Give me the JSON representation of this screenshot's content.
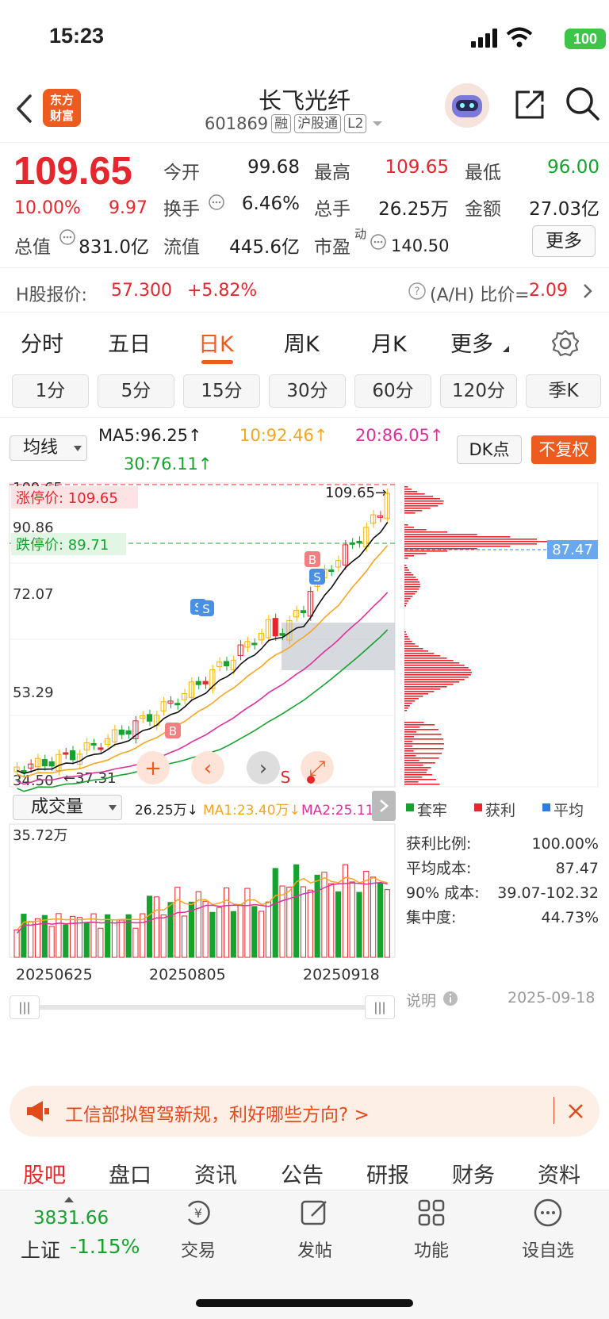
{
  "status_bar": {
    "time": "15:23",
    "battery": "100"
  },
  "header": {
    "logo_line1": "东方",
    "logo_line2": "财富",
    "stock_name": "长飞光纤",
    "stock_code": "601869",
    "tags": [
      "融",
      "沪股通",
      "L2"
    ]
  },
  "quote": {
    "price": "109.65",
    "change_pct": "10.00%",
    "change_amt": "9.97",
    "open_label": "今开",
    "open": "99.68",
    "high_label": "最高",
    "high": "109.65",
    "low_label": "最低",
    "low": "96.00",
    "turnover_rate_label": "换手",
    "turnover_rate": "6.46%",
    "volume_label": "总手",
    "volume": "26.25万",
    "amount_label": "金额",
    "amount": "27.03亿",
    "total_cap_label": "总值",
    "total_cap": "831.0亿",
    "float_cap_label": "流值",
    "float_cap": "445.6亿",
    "pe_label": "市盈",
    "pe_sup": "动",
    "pe": "140.50",
    "more_button": "更多"
  },
  "h_share": {
    "label": "H股报价:",
    "price": "57.300",
    "change": "+5.82%",
    "ratio_label": "(A/H) 比价=",
    "ratio": "2.09"
  },
  "kline_tabs": {
    "items": [
      "分时",
      "五日",
      "日K",
      "周K",
      "月K",
      "更多"
    ],
    "active": "日K"
  },
  "periods": [
    "1分",
    "5分",
    "15分",
    "30分",
    "60分",
    "120分",
    "季K"
  ],
  "indicators": {
    "ma_select": "均线",
    "ma5": "MA5:96.25↑",
    "ma10": "10:92.46↑",
    "ma20": "20:86.05↑",
    "ma30": "30:76.11↑",
    "dk_button": "DK点",
    "fq_button": "不复权"
  },
  "chart": {
    "price_labels": [
      "109.65",
      "90.86",
      "72.07",
      "53.29",
      "34.50"
    ],
    "limit_up_label": "涨停价: 109.65",
    "limit_down_label": "跌停价: 89.71",
    "latest_marker": "109.65",
    "low_marker": "37.31",
    "avg_cost_marker": "87.47",
    "vol_select": "成交量",
    "vol_value": "26.25万↓",
    "vol_ma1": "MA1:23.40万↓",
    "vol_ma2": "MA2:25.11万",
    "vol_top": "35.72万",
    "dates": [
      "20250625",
      "20250805",
      "20250918"
    ]
  },
  "chips": {
    "legend": [
      "套牢",
      "获利",
      "平均"
    ],
    "rows": [
      {
        "label": "获利比例:",
        "value": "100.00%"
      },
      {
        "label": "平均成本:",
        "value": "87.47"
      },
      {
        "label": "90% 成本:",
        "value": "39.07-102.32"
      },
      {
        "label": "集中度:",
        "value": "44.73%"
      }
    ],
    "note_label": "说明",
    "date": "2025-09-18"
  },
  "banner": {
    "text": "工信部拟智驾新规，利好哪些方向? >"
  },
  "bottom_tabs": [
    "股吧",
    "盘口",
    "资讯",
    "公告",
    "研报",
    "财务",
    "资料"
  ],
  "bottom_bar": {
    "index_value": "3831.66",
    "index_name": "上证",
    "index_change": "-1.15%",
    "items": [
      "交易",
      "发帖",
      "功能",
      "设自选"
    ]
  },
  "colors": {
    "up": "#e5262d",
    "down": "#17a22f",
    "accent": "#ee5b1f"
  }
}
